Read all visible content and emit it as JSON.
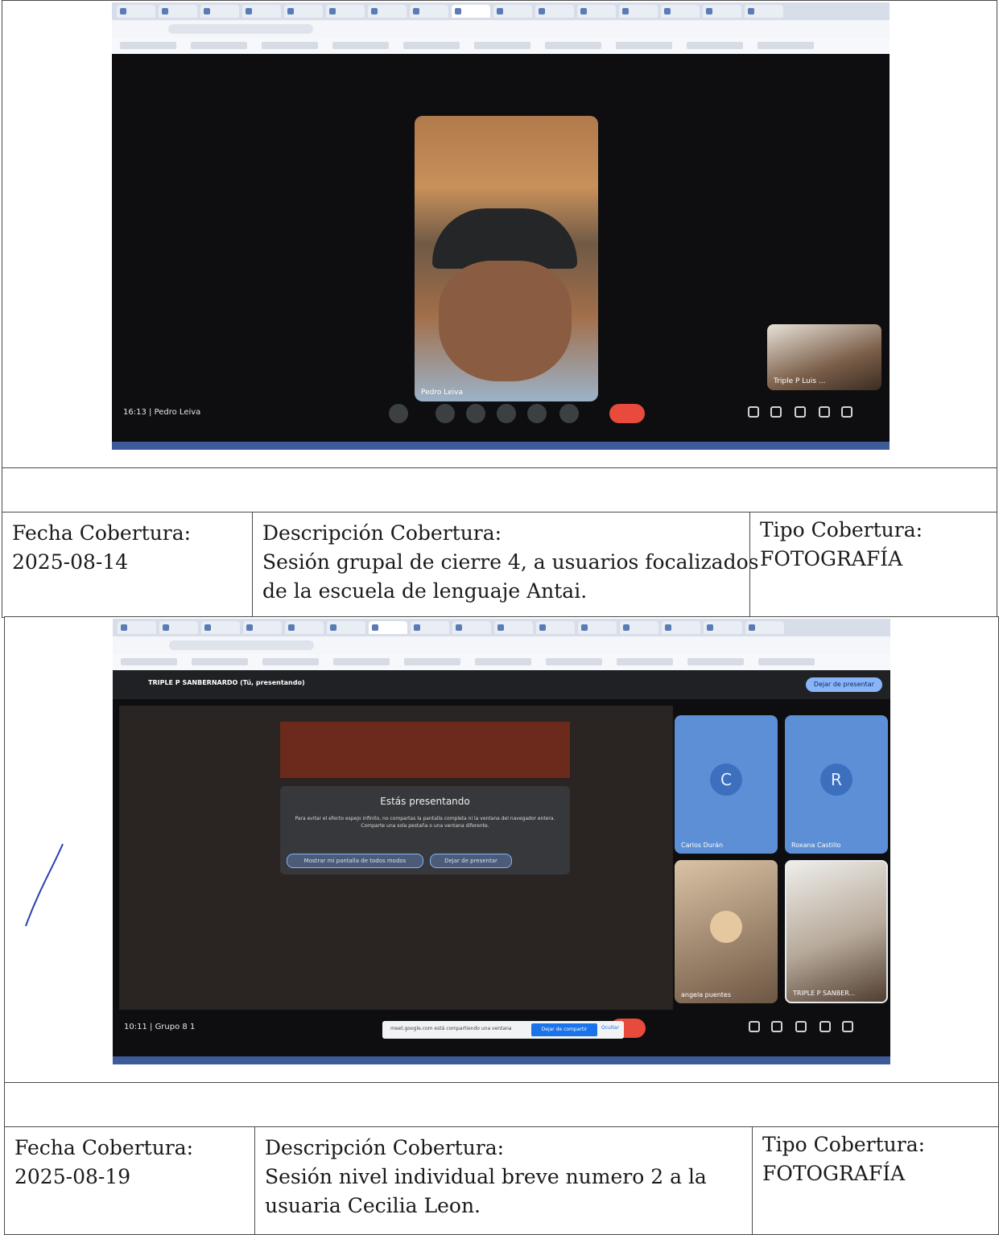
{
  "screenshot1": {
    "main_participant": "Pedro Leiva",
    "small_tile_name": "Triple P Luis ...",
    "meeting_time": "16:13",
    "meeting_label": "Pedro Leiva"
  },
  "record1": {
    "fecha_label": "Fecha Cobertura:",
    "fecha_value": "2025-08-14",
    "descripcion_label": "Descripción Cobertura:",
    "descripcion_line1": "Sesión grupal de cierre 4, a usuarios focalizados",
    "descripcion_line2": "de la escuela de lenguaje Antai.",
    "tipo_label": "Tipo Cobertura:",
    "tipo_value": "FOTOGRAFÍA"
  },
  "screenshot2": {
    "presenting_header": "TRIPLE P SANBERNARDO (Tú, presentando)",
    "stop_presenting": "Dejar de presentar",
    "dialog_title": "Estás presentando",
    "dialog_body": "Para evitar el efecto espejo infinito, no compartas la pantalla completa ni la ventana del navegador entera. Comparte una sola pestaña o una ventana diferente.",
    "dialog_btn_show": "Mostrar mi pantalla de todos modos",
    "dialog_btn_stop": "Dejar de presentar",
    "tiles": [
      {
        "initial": "C",
        "name": "Carlos Durán"
      },
      {
        "initial": "R",
        "name": "Roxana Castillo"
      },
      {
        "initial": "",
        "name": "angela puentes"
      },
      {
        "initial": "",
        "name": "TRIPLE P SANBER..."
      }
    ],
    "meeting_time": "10:11",
    "meeting_label": "Grupo 8 1",
    "share_text": "meet.google.com está compartiendo una ventana",
    "share_stop": "Dejar de compartir",
    "share_hide": "Ocultar"
  },
  "record2": {
    "fecha_label": "Fecha Cobertura:",
    "fecha_value": "2025-08-19",
    "descripcion_label": "Descripción Cobertura:",
    "descripcion_line1": "Sesión nivel individual breve numero 2 a la",
    "descripcion_line2": "usuaria Cecilia Leon.",
    "tipo_label": "Tipo Cobertura:",
    "tipo_value": "FOTOGRAFÍA"
  }
}
